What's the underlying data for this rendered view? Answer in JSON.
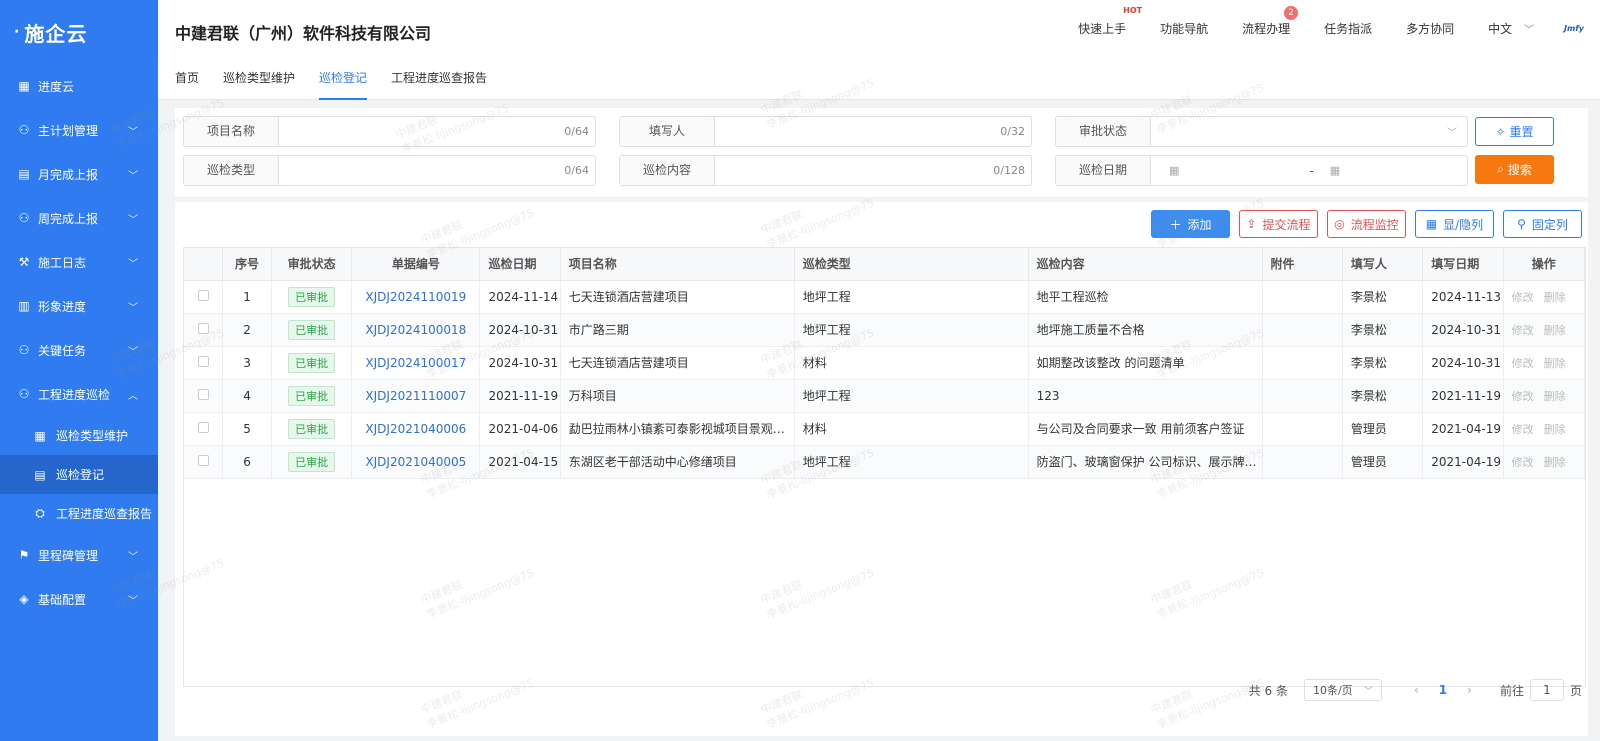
{
  "logo": {
    "text": "施企云"
  },
  "sidebar": {
    "items": [
      {
        "label": "进度云",
        "icon": "grid-icon"
      },
      {
        "label": "主计划管理",
        "icon": "org-icon"
      },
      {
        "label": "月完成上报",
        "icon": "clipboard-icon"
      },
      {
        "label": "周完成上报",
        "icon": "org-icon"
      },
      {
        "label": "施工日志",
        "icon": "construct-icon"
      },
      {
        "label": "形象进度",
        "icon": "chart-icon"
      },
      {
        "label": "关键任务",
        "icon": "org-icon"
      },
      {
        "label": "工程进度巡检",
        "icon": "org-icon"
      }
    ],
    "subitems": [
      {
        "label": "巡检类型维护"
      },
      {
        "label": "巡检登记"
      },
      {
        "label": "工程进度巡查报告"
      }
    ],
    "bottom_items": [
      {
        "label": "里程碑管理"
      },
      {
        "label": "基础配置"
      }
    ]
  },
  "header": {
    "company": "中建君联（广州）软件科技有限公司",
    "nav": [
      "快速上手",
      "功能导航",
      "流程办理",
      "任务指派",
      "多方协同"
    ],
    "hot_label": "HOT",
    "badge_count": "2",
    "language": "中文",
    "brand": "Jmfy"
  },
  "tabs": [
    "首页",
    "巡检类型维护",
    "巡检登记",
    "工程进度巡查报告"
  ],
  "filters": {
    "project_name": {
      "label": "项目名称",
      "count": "0/64"
    },
    "filler": {
      "label": "填写人",
      "count": "0/32"
    },
    "approval_status": {
      "label": "审批状态"
    },
    "inspect_type": {
      "label": "巡检类型",
      "count": "0/64"
    },
    "inspect_content": {
      "label": "巡检内容",
      "count": "0/128"
    },
    "inspect_date": {
      "label": "巡检日期",
      "separator": "-"
    },
    "reset_label": "重置",
    "search_label": "搜索"
  },
  "toolbar": {
    "add": "添加",
    "submit_flow": "提交流程",
    "flow_monitor": "流程监控",
    "show_hide": "显/隐列",
    "fix_col": "固定列"
  },
  "table": {
    "headers": [
      "序号",
      "审批状态",
      "单据编号",
      "巡检日期",
      "项目名称",
      "巡检类型",
      "巡检内容",
      "附件",
      "填写人",
      "填写日期",
      "操作"
    ],
    "rows": [
      {
        "no": "1",
        "status": "已审批",
        "code": "XJDJ2024110019",
        "date": "2024-11-14",
        "project": "七天连锁酒店营建项目",
        "type": "地坪工程",
        "content": "地平工程巡检",
        "attach": "",
        "filler": "李景松",
        "fill_date": "2024-11-13"
      },
      {
        "no": "2",
        "status": "已审批",
        "code": "XJDJ2024100018",
        "date": "2024-10-31",
        "project": "市广路三期",
        "type": "地坪工程",
        "content": "地坪施工质量不合格",
        "attach": "",
        "filler": "李景松",
        "fill_date": "2024-10-31"
      },
      {
        "no": "3",
        "status": "已审批",
        "code": "XJDJ2024100017",
        "date": "2024-10-31",
        "project": "七天连锁酒店营建项目",
        "type": "材料",
        "content": "如期整改该整改 的问题清单",
        "attach": "",
        "filler": "李景松",
        "fill_date": "2024-10-31"
      },
      {
        "no": "4",
        "status": "已审批",
        "code": "XJDJ2021110007",
        "date": "2021-11-19",
        "project": "万科项目",
        "type": "地坪工程",
        "content": "123",
        "attach": "",
        "filler": "李景松",
        "fill_date": "2021-11-19"
      },
      {
        "no": "5",
        "status": "已审批",
        "code": "XJDJ2021040006",
        "date": "2021-04-06",
        "project": "勐巴拉雨林小镇紊可泰影视城项目景观工程",
        "type": "材料",
        "content": "与公司及合同要求一致 用前须客户签证",
        "attach": "",
        "filler": "管理员",
        "fill_date": "2021-04-19"
      },
      {
        "no": "6",
        "status": "已审批",
        "code": "XJDJ2021040005",
        "date": "2021-04-15",
        "project": "东湖区老干部活动中心修缮项目",
        "type": "地坪工程",
        "content": "防盗门、玻璃窗保护 公司标识、展示牌及...",
        "attach": "",
        "filler": "管理员",
        "fill_date": "2021-04-19"
      }
    ],
    "op_edit": "修改",
    "op_delete": "删除"
  },
  "pager": {
    "total": "共 6 条",
    "page_size": "10条/页",
    "current": "1",
    "goto_prefix": "前往",
    "goto_value": "1",
    "goto_suffix": "页"
  },
  "watermark": {
    "line1": "中建君联",
    "line2": "李景松-lijingsong@75"
  },
  "colors": {
    "sidebar": "#2f7bef",
    "accent": "#2f7bef",
    "search": "#f7780f",
    "danger": "#e05252",
    "success": "#2da54a"
  }
}
